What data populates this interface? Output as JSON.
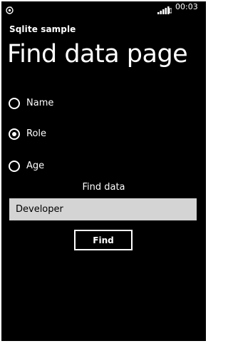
{
  "status_bar": {
    "time": "00:03",
    "left_icon": "sync-icon",
    "right_icon": "signal-icon"
  },
  "app": {
    "title": "Sqlite sample"
  },
  "page": {
    "title": "Find data page"
  },
  "radio_options": [
    {
      "label": "Name",
      "selected": false
    },
    {
      "label": "Role",
      "selected": true
    },
    {
      "label": "Age",
      "selected": false
    }
  ],
  "search": {
    "label": "Find data",
    "value": "Developer"
  },
  "find_button": {
    "label": "Find"
  },
  "colors": {
    "background": "#000000",
    "foreground": "#ffffff",
    "input_background": "#d4d4d4"
  }
}
